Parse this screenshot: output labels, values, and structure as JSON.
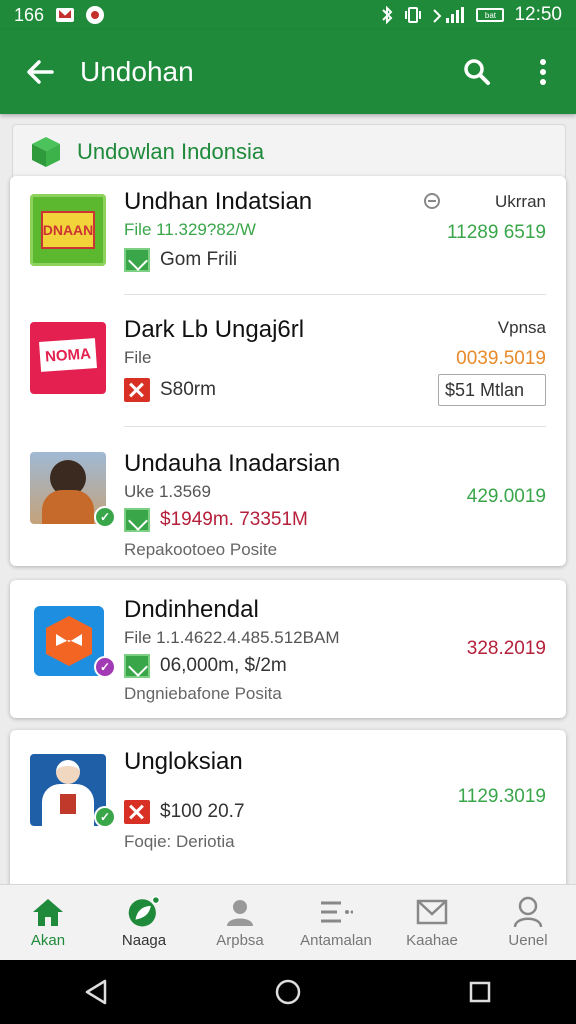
{
  "status_bar": {
    "left_text": "166",
    "battery_text": "bat",
    "time": "12:50",
    "icons": [
      "mail-icon",
      "notification-icon",
      "bluetooth-icon",
      "vibrate-icon",
      "signal-icon",
      "battery-icon"
    ]
  },
  "app_bar": {
    "title": "Undohan",
    "icons": [
      "back-arrow-icon",
      "search-icon",
      "more-vert-icon"
    ]
  },
  "section": {
    "title": "Undowlan Indonsia",
    "icon": "cube-icon"
  },
  "items": [
    {
      "name": "Undhan Indatsian",
      "sub": "File 11.329?82/W",
      "meta": "Gom Frili",
      "meta_icon": "green-tag-icon",
      "right_label": "Ukrran",
      "amount": "11289 6519",
      "amount_color": "#3aa64a",
      "thumb_text": "DNAAN",
      "thumb_bg": "#5cb82f"
    },
    {
      "name": "Dark Lb Ungaj6rl",
      "sub": "File",
      "meta": "S80rm",
      "meta_icon": "red-x-icon",
      "right_label": "Vpnsa",
      "amount": "0039.5019",
      "amount_color": "#e88a2a",
      "chip_text": "$51 Mtlan",
      "thumb_text": "NOMA",
      "thumb_bg": "#e3204f"
    },
    {
      "name": "Undauha Inadarsian",
      "sub": "Uke 1.3569",
      "meta": "$1949m. 73351M",
      "meta_icon": "green-tag-icon",
      "note": "Repakootoeo Posite",
      "amount": "429.0019",
      "amount_color": "#3aa64a"
    },
    {
      "name": "Dndinhendal",
      "sub": "File 1.1.4622.4.485.512BAM",
      "meta": "06,000m, $/2m",
      "meta_icon": "green-tag-icon",
      "note": "Dngniebafone Posita",
      "amount": "328.2019",
      "amount_color": "#b51f3a"
    },
    {
      "name": "Ungloksian",
      "meta": "$100 20.7",
      "meta_icon": "red-x-icon",
      "note": "Foqie: Deriotia",
      "amount": "1129.3019",
      "amount_color": "#3aa64a"
    }
  ],
  "bottom_nav": [
    {
      "label": "Akan",
      "icon": "home-icon",
      "active": true
    },
    {
      "label": "Naaga",
      "icon": "leaf-icon",
      "active": false
    },
    {
      "label": "Arpbsa",
      "icon": "person-icon",
      "active": false
    },
    {
      "label": "Antamalan",
      "icon": "list-icon",
      "active": false
    },
    {
      "label": "Kaahae",
      "icon": "mail-icon",
      "active": false
    },
    {
      "label": "Uenel",
      "icon": "account-icon",
      "active": false
    }
  ],
  "system_nav": [
    "back-triangle-icon",
    "home-circle-icon",
    "recents-square-icon"
  ],
  "colors": {
    "primary": "#1e8a3a",
    "background": "#ececec"
  }
}
